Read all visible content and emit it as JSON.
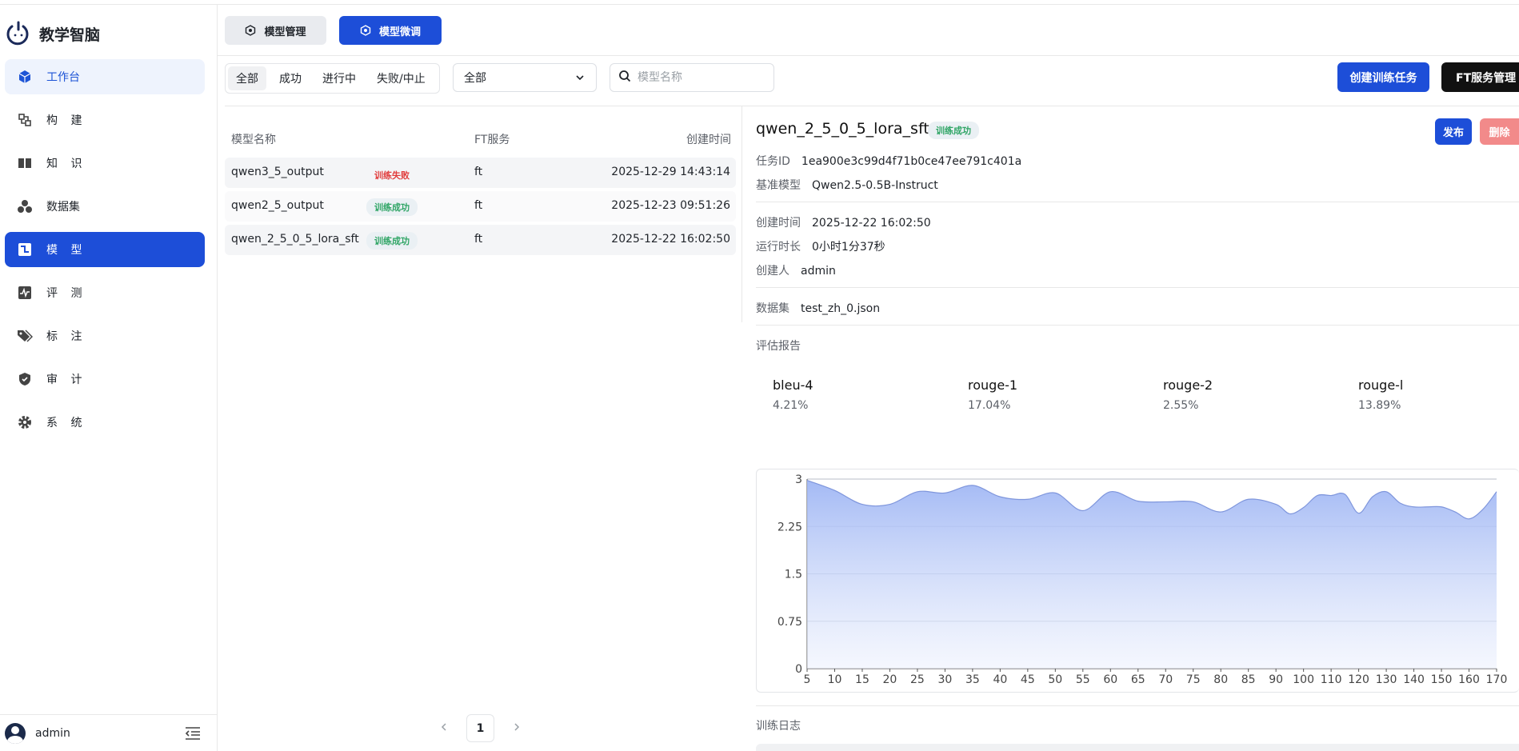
{
  "app": {
    "name": "教学智脑"
  },
  "sidebar": {
    "items": [
      {
        "label": "工作台",
        "icon": "cube-icon",
        "state": "soft"
      },
      {
        "label": "构 建",
        "icon": "build-icon",
        "state": ""
      },
      {
        "label": "知 识",
        "icon": "book-icon",
        "state": ""
      },
      {
        "label": "数据集",
        "icon": "dataset-icon",
        "state": ""
      },
      {
        "label": "模 型",
        "icon": "model-icon",
        "state": "active"
      },
      {
        "label": "评 测",
        "icon": "pulse-icon",
        "state": ""
      },
      {
        "label": "标 注",
        "icon": "tag-icon",
        "state": ""
      },
      {
        "label": "审 计",
        "icon": "shield-icon",
        "state": ""
      },
      {
        "label": "系 统",
        "icon": "gear-icon",
        "state": ""
      }
    ],
    "user": "admin"
  },
  "tabs": {
    "manage": "模型管理",
    "finetune": "模型微调"
  },
  "filters": {
    "segments": [
      "全部",
      "成功",
      "进行中",
      "失败/中止"
    ],
    "selected_segment": "全部",
    "select_value": "全部",
    "search_placeholder": "模型名称"
  },
  "actions": {
    "create": "创建训练任务",
    "ft_service": "FT服务管理"
  },
  "table": {
    "headers": {
      "name": "模型名称",
      "ft": "FT服务",
      "time": "创建时间"
    },
    "rows": [
      {
        "name": "qwen3_5_output",
        "status": "训练失败",
        "status_type": "fail",
        "ft": "ft",
        "time": "2025-12-29 14:43:14"
      },
      {
        "name": "qwen2_5_output",
        "status": "训练成功",
        "status_type": "ok",
        "ft": "ft",
        "time": "2025-12-23 09:51:26"
      },
      {
        "name": "qwen_2_5_0_5_lora_sft",
        "status": "训练成功",
        "status_type": "ok",
        "ft": "ft",
        "time": "2025-12-22 16:02:50"
      }
    ],
    "page": "1"
  },
  "detail": {
    "title": "qwen_2_5_0_5_lora_sft",
    "status": "训练成功",
    "publish": "发布",
    "delete": "删除",
    "task_id_label": "任务ID",
    "task_id": "1ea900e3c99d4f71b0ce47ee791c401a",
    "base_model_label": "基准模型",
    "base_model": "Qwen2.5-0.5B-Instruct",
    "created_label": "创建时间",
    "created": "2025-12-22 16:02:50",
    "runtime_label": "运行时长",
    "runtime": "0小时1分37秒",
    "creator_label": "创建人",
    "creator": "admin",
    "dataset_label": "数据集",
    "dataset": "test_zh_0.json",
    "eval_label": "评估报告",
    "metrics": [
      {
        "name": "bleu-4",
        "value": "4.21%"
      },
      {
        "name": "rouge-1",
        "value": "17.04%"
      },
      {
        "name": "rouge-2",
        "value": "2.55%"
      },
      {
        "name": "rouge-l",
        "value": "13.89%"
      }
    ],
    "log_label": "训练日志"
  },
  "colors": {
    "primary": "#1d4ed8",
    "success": "#2fa565",
    "danger": "#e13c3c",
    "area_top": "#9fb6f4",
    "line": "#7f96dc"
  },
  "chart_data": {
    "type": "area",
    "title": "",
    "xlabel": "",
    "ylabel": "",
    "ylim": [
      0,
      3
    ],
    "yticks": [
      "0",
      "0.75",
      "1.5",
      "2.25",
      "3"
    ],
    "xticks": [
      "5",
      "10",
      "15",
      "20",
      "25",
      "30",
      "35",
      "40",
      "45",
      "50",
      "55",
      "60",
      "65",
      "70",
      "75",
      "80",
      "85",
      "90",
      "100",
      "110",
      "120",
      "130",
      "140",
      "150",
      "160",
      "170"
    ],
    "x": [
      5,
      10,
      15,
      20,
      25,
      30,
      35,
      40,
      45,
      50,
      55,
      60,
      65,
      70,
      75,
      80,
      85,
      90,
      95,
      100,
      105,
      110,
      115,
      120,
      125,
      130,
      135,
      140,
      145,
      150,
      155,
      160,
      165,
      170
    ],
    "values": [
      2.98,
      2.82,
      2.6,
      2.6,
      2.8,
      2.78,
      2.9,
      2.72,
      2.68,
      2.78,
      2.5,
      2.8,
      2.65,
      2.64,
      2.64,
      2.48,
      2.68,
      2.6,
      2.45,
      2.55,
      2.74,
      2.74,
      2.76,
      2.46,
      2.72,
      2.8,
      2.62,
      2.56,
      2.56,
      2.56,
      2.48,
      2.37,
      2.52,
      2.8
    ],
    "grid": true
  }
}
